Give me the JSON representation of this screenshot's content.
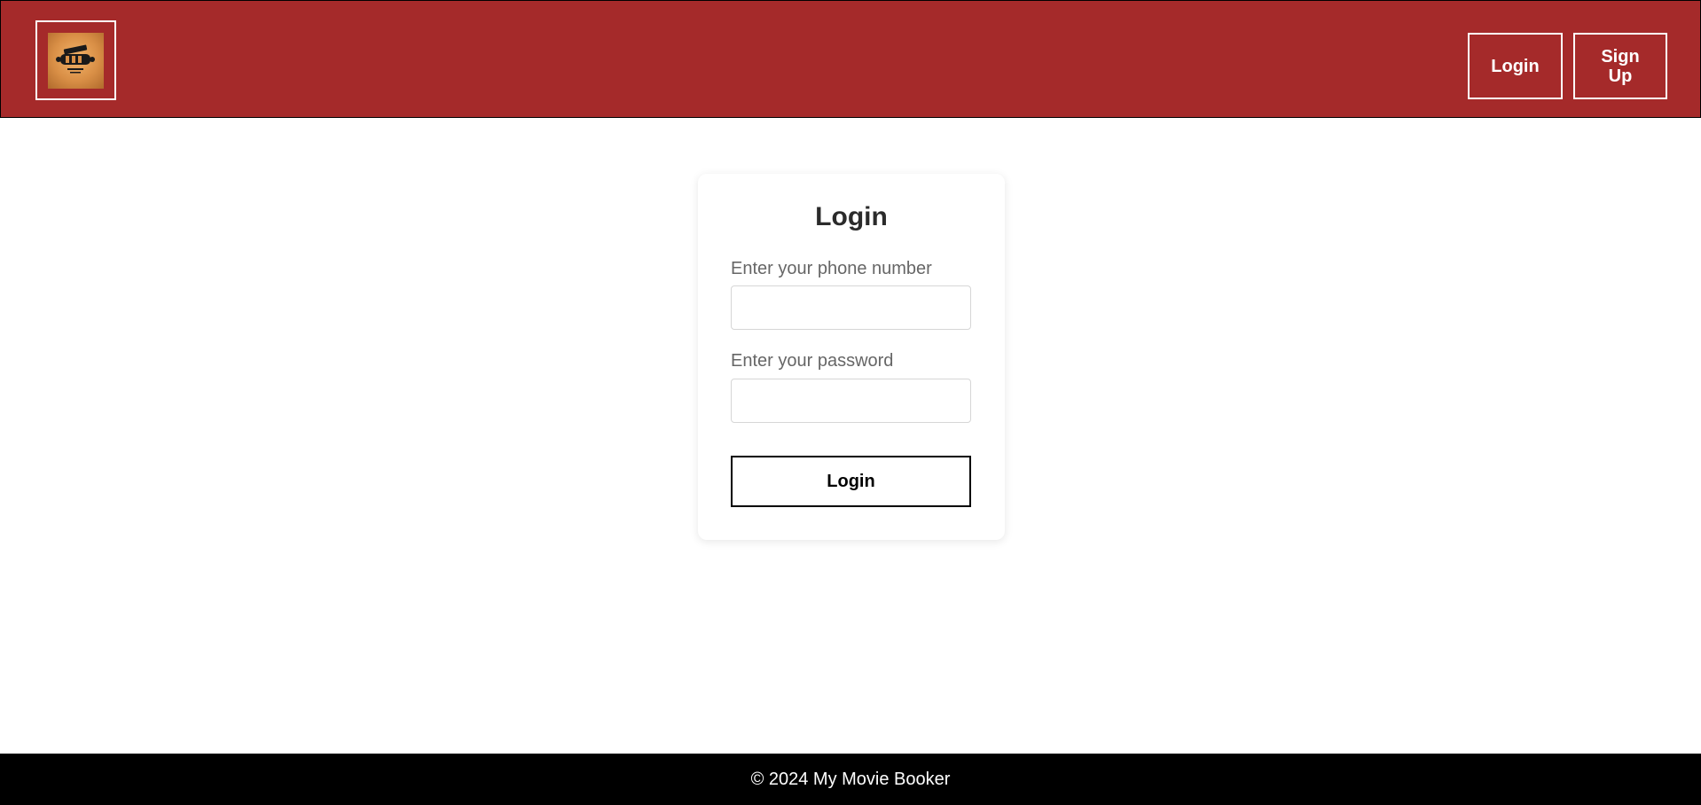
{
  "header": {
    "logo": {
      "icon": "movie-clapper-logo-icon",
      "background_color": "#d98f46"
    },
    "nav": {
      "login_label": "Login",
      "signup_label": "Sign Up"
    },
    "background_color": "#a52a2a"
  },
  "login_form": {
    "title": "Login",
    "phone_label": "Enter your phone number",
    "phone_value": "",
    "password_label": "Enter your password",
    "password_value": "",
    "submit_label": "Login"
  },
  "footer": {
    "text": "© 2024 My Movie Booker",
    "background_color": "#000000"
  }
}
